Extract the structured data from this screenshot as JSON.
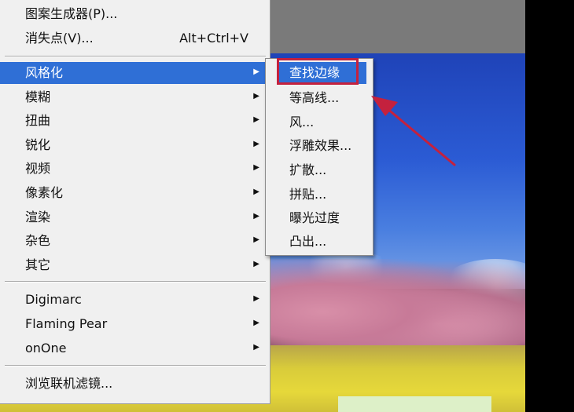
{
  "menu": {
    "items": [
      {
        "label": "图案生成器(P)...",
        "shortcut": "",
        "submenu": false,
        "highlighted": false
      },
      {
        "label": "消失点(V)...",
        "shortcut": "Alt+Ctrl+V",
        "submenu": false,
        "highlighted": false
      },
      {
        "label": "风格化",
        "shortcut": "",
        "submenu": true,
        "highlighted": true
      },
      {
        "label": "模糊",
        "shortcut": "",
        "submenu": true,
        "highlighted": false
      },
      {
        "label": "扭曲",
        "shortcut": "",
        "submenu": true,
        "highlighted": false
      },
      {
        "label": "锐化",
        "shortcut": "",
        "submenu": true,
        "highlighted": false
      },
      {
        "label": "视频",
        "shortcut": "",
        "submenu": true,
        "highlighted": false
      },
      {
        "label": "像素化",
        "shortcut": "",
        "submenu": true,
        "highlighted": false
      },
      {
        "label": "渲染",
        "shortcut": "",
        "submenu": true,
        "highlighted": false
      },
      {
        "label": "杂色",
        "shortcut": "",
        "submenu": true,
        "highlighted": false
      },
      {
        "label": "其它",
        "shortcut": "",
        "submenu": true,
        "highlighted": false
      },
      {
        "label": "Digimarc",
        "shortcut": "",
        "submenu": true,
        "highlighted": false
      },
      {
        "label": "Flaming Pear",
        "shortcut": "",
        "submenu": true,
        "highlighted": false
      },
      {
        "label": "onOne",
        "shortcut": "",
        "submenu": true,
        "highlighted": false
      },
      {
        "label": "浏览联机滤镜...",
        "shortcut": "",
        "submenu": false,
        "highlighted": false
      }
    ],
    "submenu_arrow": "▶"
  },
  "submenu": {
    "items": [
      {
        "label": "查找边缘",
        "highlighted": true
      },
      {
        "label": "等高线...",
        "highlighted": false
      },
      {
        "label": "风...",
        "highlighted": false
      },
      {
        "label": "浮雕效果...",
        "highlighted": false
      },
      {
        "label": "扩散...",
        "highlighted": false
      },
      {
        "label": "拼贴...",
        "highlighted": false
      },
      {
        "label": "曝光过度",
        "highlighted": false
      },
      {
        "label": "凸出...",
        "highlighted": false
      }
    ]
  },
  "colors": {
    "highlight": "#2f6fd6",
    "annotation": "#c4213e"
  },
  "icons": {
    "submenu_arrow": "triangle-right-icon",
    "annotation_arrow": "red-pointer-arrow-icon"
  }
}
